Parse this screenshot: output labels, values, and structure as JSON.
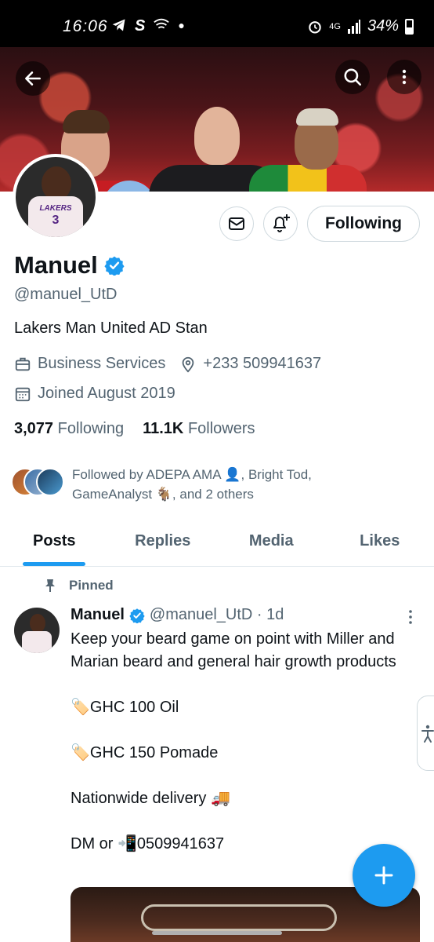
{
  "status_bar": {
    "time": "16:06",
    "left_icons": [
      "telegram-icon",
      "dollar-icon",
      "wifi-call-icon",
      "dot-icon"
    ],
    "network": "4G",
    "battery": "34%"
  },
  "profile": {
    "name": "Manuel",
    "verified": true,
    "handle": "@manuel_UtD",
    "bio": "Lakers Man United AD Stan",
    "category": "Business Services",
    "phone": "+233 509941637",
    "joined": "Joined August 2019",
    "following_count": "3,077",
    "following_label": "Following",
    "followers_count": "11.1K",
    "followers_label": "Followers",
    "followed_by": "Followed by ADEPA AMA 👤, Bright Tod, GameAnalyst 🐐, and 2 others",
    "avatar_jersey_text": "LAKERS",
    "avatar_jersey_number": "3"
  },
  "actions": {
    "following_button": "Following"
  },
  "tabs": [
    {
      "label": "Posts",
      "active": true
    },
    {
      "label": "Replies",
      "active": false
    },
    {
      "label": "Media",
      "active": false
    },
    {
      "label": "Likes",
      "active": false
    }
  ],
  "post": {
    "pinned_label": "Pinned",
    "author": "Manuel",
    "handle_time": "@manuel_UtD · 1d",
    "text": "Keep your beard game on point with Miller and Marian beard and general hair growth products\n\n🏷️GHC 100 Oil\n\n🏷️GHC 150 Pomade\n\nNationwide delivery 🚚\n\nDM or 📲0509941637"
  },
  "colors": {
    "accent": "#1d9bf0",
    "text_primary": "#0f1419",
    "text_secondary": "#536471",
    "border": "#cfd9de"
  }
}
